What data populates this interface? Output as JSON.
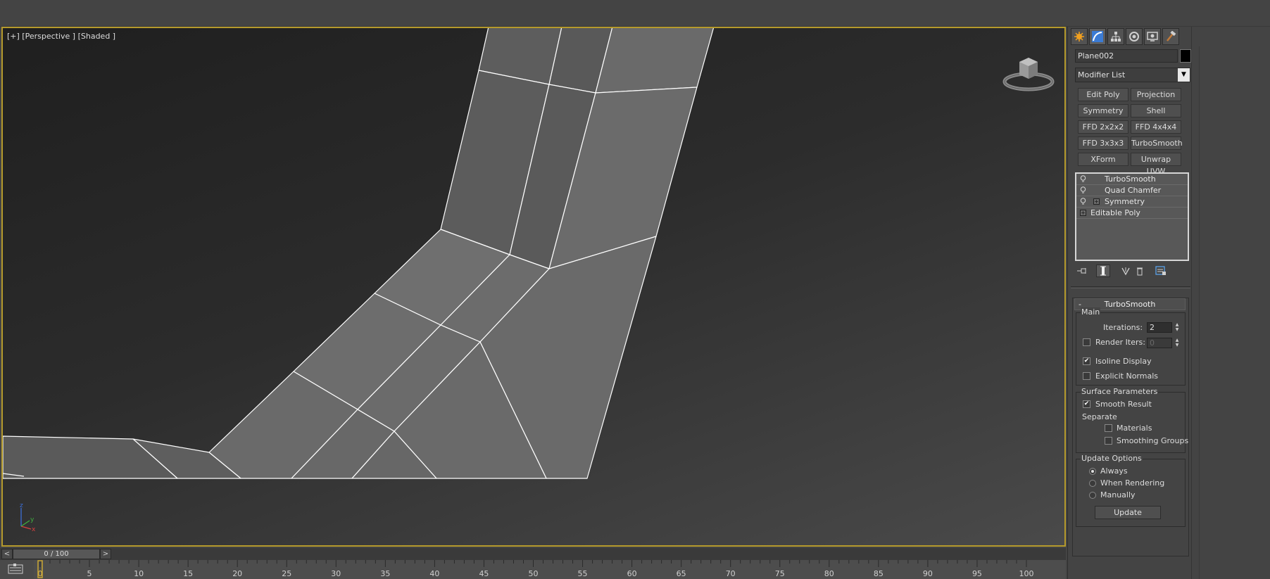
{
  "viewport": {
    "label": "[+] [Perspective ] [Shaded ]",
    "axis_labels": {
      "x": "x",
      "y": "y",
      "z": "z"
    }
  },
  "timeline": {
    "prev": "<",
    "position": "0 / 100",
    "next": ">",
    "ticks": [
      "0",
      "5",
      "10",
      "15",
      "20",
      "25",
      "30",
      "35",
      "40",
      "45",
      "50",
      "55",
      "60",
      "65",
      "70",
      "75",
      "80",
      "85",
      "90",
      "95",
      "100"
    ]
  },
  "command_panel": {
    "tabs": [
      "create-icon",
      "modify-icon",
      "hierarchy-icon",
      "motion-icon",
      "display-icon",
      "utilities-icon"
    ],
    "object_name": "Plane002",
    "object_color": "#000000",
    "modifier_list": "Modifier List",
    "modifier_buttons": [
      "Edit Poly",
      "Projection",
      "Symmetry",
      "Shell",
      "FFD 2x2x2",
      "FFD 4x4x4",
      "FFD 3x3x3",
      "TurboSmooth",
      "XForm",
      "Unwrap UVW"
    ],
    "stack": [
      "TurboSmooth",
      "Quad Chamfer",
      "Symmetry",
      "Editable Poly"
    ],
    "rollout": {
      "title": "TurboSmooth",
      "collapse": "-",
      "main": {
        "title": "Main",
        "iterations_label": "Iterations:",
        "iterations_value": "2",
        "render_iters_label": "Render Iters:",
        "render_iters_value": "0",
        "isoline_label": "Isoline Display",
        "explicit_normals_label": "Explicit Normals"
      },
      "surface": {
        "title": "Surface Parameters",
        "smooth_result_label": "Smooth Result",
        "separate_label": "Separate",
        "materials_label": "Materials",
        "smoothing_groups_label": "Smoothing Groups"
      },
      "update_options": {
        "title": "Update Options",
        "always_label": "Always",
        "when_rendering_label": "When Rendering",
        "manually_label": "Manually",
        "update_button": "Update"
      }
    }
  },
  "colors": {
    "viewport_border": "#b59a2c",
    "wire": "#ffffff",
    "face_light": "#6e6e6e",
    "face_dark": "#5a5a5a"
  }
}
